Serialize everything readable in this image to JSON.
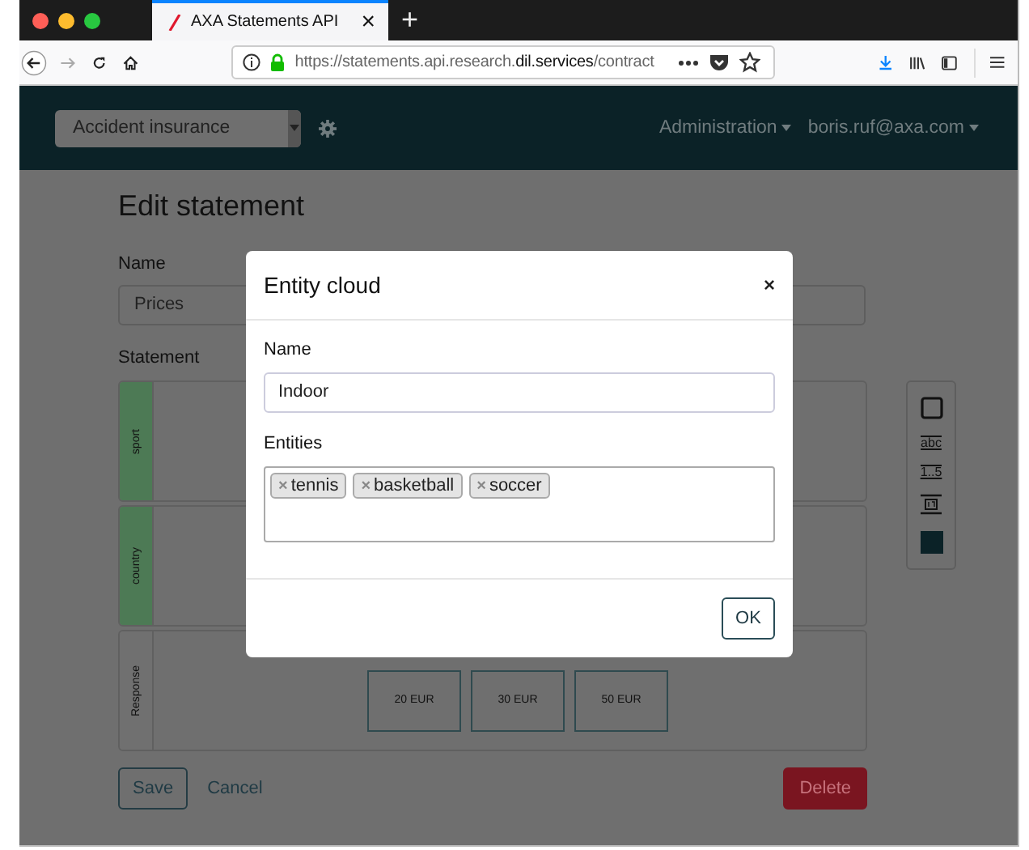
{
  "browser": {
    "tab": {
      "title": "AXA Statements API",
      "selected": true,
      "close": "×"
    },
    "new_tab": "+",
    "url": "https://statements.api.research.**dil.services**/contract"
  },
  "navbar": {
    "product": "Accident insurance",
    "links": [
      "Administration",
      "boris.ruf@axa.com"
    ]
  },
  "page": {
    "title": "Edit statement",
    "name_label": "Name",
    "name_value": "Prices",
    "statement_label": "Statement",
    "rows": [
      {
        "label": "sport",
        "color": "#4d7a55",
        "options": []
      },
      {
        "label": "country",
        "color": "#4d7a55",
        "options": []
      },
      {
        "label": "Response",
        "color": "#707070",
        "options": [
          "20 EUR",
          "30 EUR",
          "50 EUR"
        ]
      }
    ],
    "tools": [
      {
        "kind": "box"
      },
      {
        "kind": "text",
        "label": "abc"
      },
      {
        "kind": "range",
        "label": "1..5"
      },
      {
        "kind": "date"
      },
      {
        "kind": "color"
      }
    ],
    "save": "Save",
    "cancel": "Cancel",
    "delete": "Delete"
  },
  "modal": {
    "title": "Entity cloud",
    "close": "×",
    "name_label": "Name",
    "name_value": "Indoor",
    "entities_label": "Entities",
    "entities": [
      {
        "label": "tennis",
        "remove": "×"
      },
      {
        "label": "basketball",
        "remove": "×"
      },
      {
        "label": "soccer",
        "remove": "×"
      }
    ],
    "ok": "OK"
  }
}
